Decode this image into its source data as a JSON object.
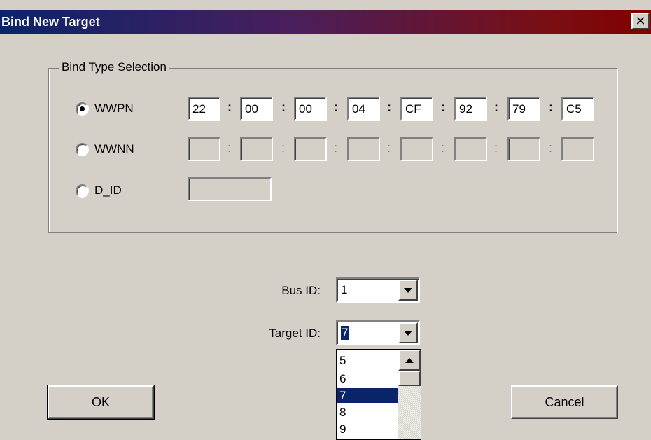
{
  "window": {
    "title": "Bind New Target",
    "close_glyph": "✕"
  },
  "group": {
    "legend": "Bind Type Selection"
  },
  "wwpn": {
    "label": "WWPN",
    "selected": true,
    "octets": [
      "22",
      "00",
      "00",
      "04",
      "CF",
      "92",
      "79",
      "C5"
    ]
  },
  "wwnn": {
    "label": "WWNN",
    "selected": false
  },
  "did": {
    "label": "D_ID",
    "selected": false
  },
  "separator": ":",
  "bus": {
    "label": "Bus ID:",
    "value": "1"
  },
  "target": {
    "label": "Target ID:",
    "value": "7",
    "options_visible": [
      "5",
      "6",
      "7",
      "8",
      "9"
    ],
    "highlighted": "7"
  },
  "buttons": {
    "ok": "OK",
    "cancel": "Cancel"
  },
  "icons": {
    "close": "close-icon",
    "combo_arrow": "chevron-down-icon",
    "scroll_up": "chevron-up-icon"
  },
  "colors": {
    "title_start": "#0a246a",
    "title_end": "#800000",
    "selection": "#0a246a",
    "face": "#d4d0c8"
  }
}
